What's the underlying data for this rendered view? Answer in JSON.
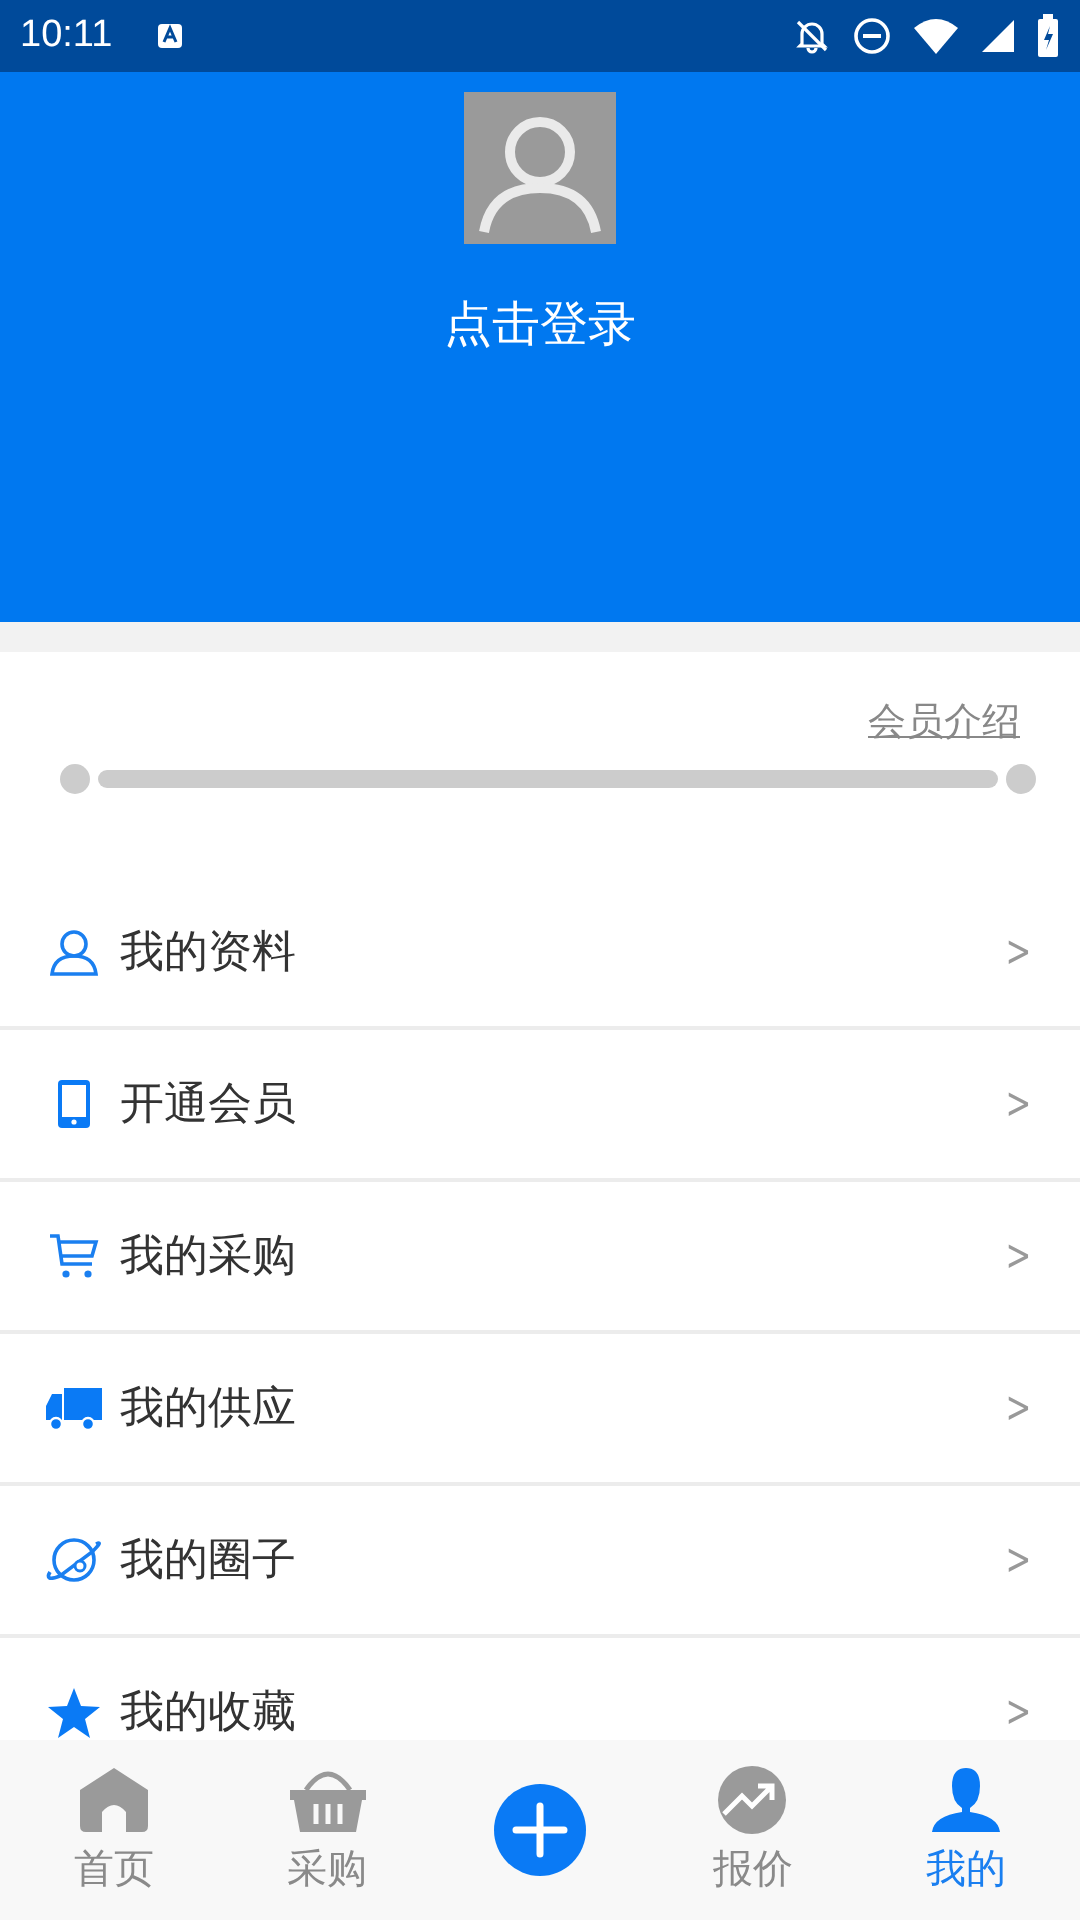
{
  "status_bar": {
    "time": "10:11"
  },
  "profile": {
    "login_text": "点击登录"
  },
  "membership": {
    "link": "会员介绍"
  },
  "menu": [
    {
      "label": "我的资料",
      "kind": "person",
      "chevron": ">"
    },
    {
      "label": "开通会员",
      "kind": "phone",
      "chevron": ">"
    },
    {
      "label": "我的采购",
      "kind": "cart",
      "chevron": ">"
    },
    {
      "label": "我的供应",
      "kind": "truck",
      "chevron": ">"
    },
    {
      "label": "我的圈子",
      "kind": "planet",
      "chevron": ">"
    },
    {
      "label": "我的收藏",
      "kind": "star",
      "chevron": ">"
    }
  ],
  "tab_bar": [
    {
      "label": "首页",
      "kind": "home",
      "selected": false
    },
    {
      "label": "采购",
      "kind": "basket",
      "selected": false
    },
    {
      "kind": "plus",
      "selected": false
    },
    {
      "label": "报价",
      "kind": "trend",
      "selected": false
    },
    {
      "label": "我的",
      "kind": "user",
      "selected": true
    }
  ]
}
